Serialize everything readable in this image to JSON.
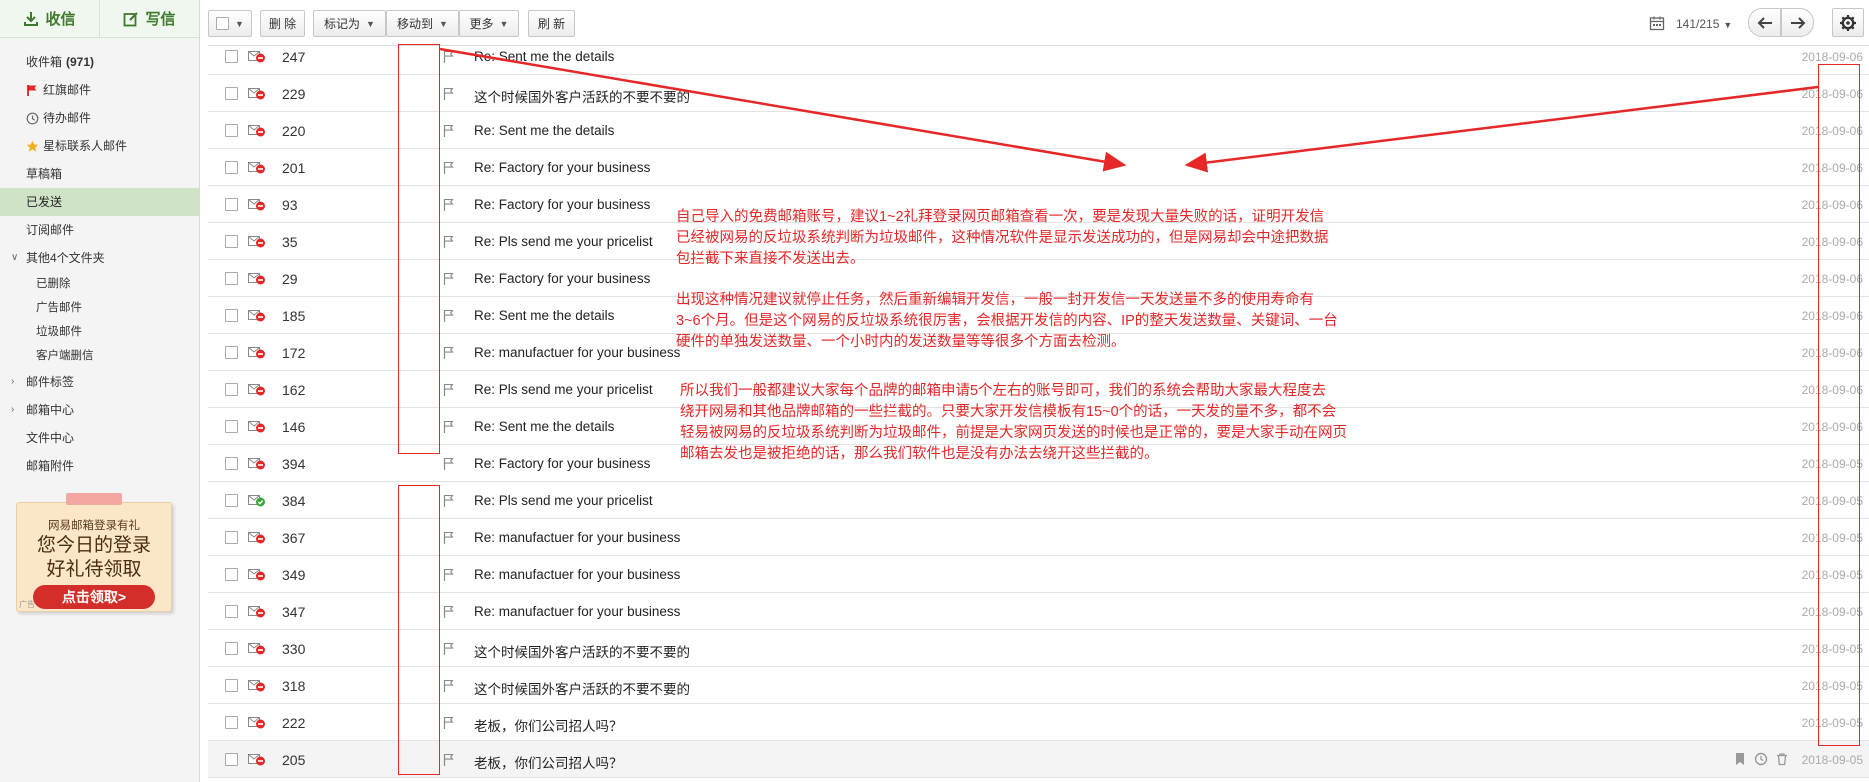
{
  "sidebar": {
    "receive_label": "收信",
    "compose_label": "写信",
    "folders": [
      {
        "label": "收件箱",
        "count": "(971)",
        "icon": "inbox"
      },
      {
        "label": "红旗邮件",
        "icon": "red-flag-icon"
      },
      {
        "label": "待办邮件",
        "icon": "clock-icon"
      },
      {
        "label": "星标联系人邮件",
        "icon": "star-icon"
      },
      {
        "label": "草稿箱"
      },
      {
        "label": "已发送",
        "active": true
      },
      {
        "label": "订阅邮件"
      },
      {
        "label": "其他4个文件夹",
        "expander": "∨"
      },
      {
        "label": "已删除",
        "sub": true
      },
      {
        "label": "广告邮件",
        "sub": true
      },
      {
        "label": "垃圾邮件",
        "sub": true
      },
      {
        "label": "客户端删信",
        "sub": true
      },
      {
        "label": "邮件标签",
        "expander": "›"
      },
      {
        "label": "邮箱中心",
        "expander": "›"
      },
      {
        "label": "文件中心"
      },
      {
        "label": "邮箱附件"
      }
    ],
    "promo": {
      "line1": "网易邮箱登录有礼",
      "line2": "您今日的登录",
      "line3": "好礼待领取",
      "button": "点击领取>",
      "tag": "广告"
    }
  },
  "toolbar": {
    "delete": "删 除",
    "mark_as": "标记为",
    "move_to": "移动到",
    "more": "更多",
    "refresh": "刷 新",
    "pager": "141/215"
  },
  "messages": [
    {
      "num": "247",
      "subject": "Re: Sent me the details",
      "date": "2018-09-06",
      "status": "failed"
    },
    {
      "num": "229",
      "subject": "这个时候国外客户活跃的不要不要的",
      "date": "2018-09-06",
      "status": "failed"
    },
    {
      "num": "220",
      "subject": "Re: Sent me the details",
      "date": "2018-09-06",
      "status": "failed"
    },
    {
      "num": "201",
      "subject": "Re: Factory for your business",
      "date": "2018-09-06",
      "status": "failed"
    },
    {
      "num": "93",
      "subject": "Re: Factory for your business",
      "date": "2018-09-06",
      "status": "failed"
    },
    {
      "num": "35",
      "subject": "Re: Pls send me your pricelist",
      "date": "2018-09-06",
      "status": "failed"
    },
    {
      "num": "29",
      "subject": "Re: Factory for your business",
      "date": "2018-09-06",
      "status": "failed"
    },
    {
      "num": "185",
      "subject": "Re: Sent me the details",
      "date": "2018-09-06",
      "status": "failed"
    },
    {
      "num": "172",
      "subject": "Re: manufactuer for your business",
      "date": "2018-09-06",
      "status": "failed"
    },
    {
      "num": "162",
      "subject": "Re: Pls send me your pricelist",
      "date": "2018-09-06",
      "status": "failed"
    },
    {
      "num": "146",
      "subject": "Re: Sent me the details",
      "date": "2018-09-06",
      "status": "failed"
    },
    {
      "num": "394",
      "subject": "Re: Factory for your business",
      "date": "2018-09-05",
      "status": "failed"
    },
    {
      "num": "384",
      "subject": "Re: Pls send me your pricelist",
      "date": "2018-09-05",
      "status": "sent"
    },
    {
      "num": "367",
      "subject": "Re: manufactuer for your business",
      "date": "2018-09-05",
      "status": "failed"
    },
    {
      "num": "349",
      "subject": "Re: manufactuer for your business",
      "date": "2018-09-05",
      "status": "failed"
    },
    {
      "num": "347",
      "subject": "Re: manufactuer for your business",
      "date": "2018-09-05",
      "status": "failed"
    },
    {
      "num": "330",
      "subject": "这个时候国外客户活跃的不要不要的",
      "date": "2018-09-05",
      "status": "failed"
    },
    {
      "num": "318",
      "subject": "这个时候国外客户活跃的不要不要的",
      "date": "2018-09-05",
      "status": "failed"
    },
    {
      "num": "222",
      "subject": "老板，你们公司招人吗？",
      "date": "2018-09-05",
      "status": "failed"
    },
    {
      "num": "205",
      "subject": "老板，你们公司招人吗？",
      "date": "2018-09-05",
      "status": "failed",
      "hovered": true
    }
  ],
  "annotations": {
    "note1": "自己导入的免费邮箱账号，建议1~2礼拜登录网页邮箱查看一次，要是发现大量失败的话，证明开发信\n已经被网易的反垃圾系统判断为垃圾邮件，这种情况软件是显示发送成功的，但是网易却会中途把数据\n包拦截下来直接不发送出去。",
    "note2": "出现这种情况建议就停止任务，然后重新编辑开发信，一般一封开发信一天发送量不多的使用寿命有\n3~6个月。但是这个网易的反垃圾系统很厉害，会根据开发信的内容、IP的整天发送数量、关键词、一台\n硬件的单独发送数量、一个小时内的发送数量等等很多个方面去检测。",
    "note3": "所以我们一般都建议大家每个品牌的邮箱申请5个左右的账号即可，我们的系统会帮助大家最大程度去\n绕开网易和其他品牌邮箱的一些拦截的。只要大家开发信模板有15~0个的话，一天发的量不多，都不会\n轻易被网易的反垃圾系统判断为垃圾邮件，前提是大家网页发送的时候也是正常的，要是大家手动在网页\n邮箱去发也是被拒绝的话，那么我们软件也是没有办法去绕开这些拦截的。",
    "color": "#e52727"
  }
}
